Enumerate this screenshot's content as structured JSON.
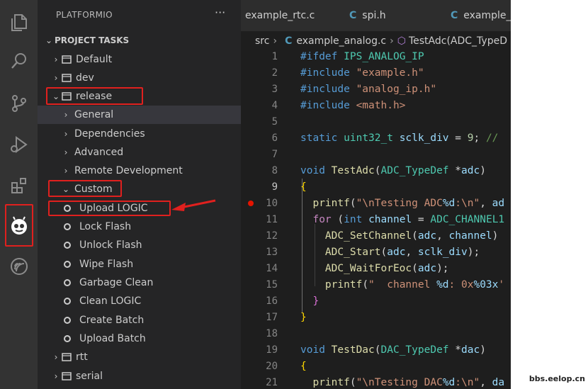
{
  "activity_bar": {
    "icons": [
      "files-icon",
      "search-icon",
      "source-control-icon",
      "run-debug-icon",
      "extensions-icon",
      "platformio-icon",
      "espressif-icon"
    ]
  },
  "sidebar": {
    "title": "PLATFORMIO",
    "more": "···",
    "section": "PROJECT TASKS",
    "items": [
      {
        "label": "Default",
        "chevron": "›",
        "icon": "folder"
      },
      {
        "label": "dev",
        "chevron": "›",
        "icon": "folder"
      },
      {
        "label": "release",
        "chevron": "⌄",
        "icon": "folder"
      },
      {
        "label": "General",
        "chevron": "›"
      },
      {
        "label": "Dependencies",
        "chevron": "›"
      },
      {
        "label": "Advanced",
        "chevron": "›"
      },
      {
        "label": "Remote Development",
        "chevron": "›"
      },
      {
        "label": "Custom",
        "chevron": "⌄"
      },
      {
        "label": "Upload LOGIC",
        "icon": "dot"
      },
      {
        "label": "Lock Flash",
        "icon": "dot"
      },
      {
        "label": "Unlock Flash",
        "icon": "dot"
      },
      {
        "label": "Wipe Flash",
        "icon": "dot"
      },
      {
        "label": "Garbage Clean",
        "icon": "dot"
      },
      {
        "label": "Clean LOGIC",
        "icon": "dot"
      },
      {
        "label": "Create Batch",
        "icon": "dot"
      },
      {
        "label": "Upload Batch",
        "icon": "dot"
      },
      {
        "label": "rtt",
        "chevron": "›",
        "icon": "folder"
      },
      {
        "label": "serial",
        "chevron": "›",
        "icon": "folder"
      }
    ]
  },
  "tabs": [
    {
      "label": "example_rtc.c",
      "lang": ""
    },
    {
      "label": "spi.h",
      "lang": "C"
    },
    {
      "label": "example_",
      "lang": "C"
    }
  ],
  "breadcrumb": {
    "folder": "src",
    "file_lang": "C",
    "file": "example_analog.c",
    "symbol": "TestAdc(ADC_TypeD"
  },
  "line_numbers": [
    "1",
    "2",
    "3",
    "4",
    "5",
    "6",
    "7",
    "8",
    "9",
    "10",
    "11",
    "12",
    "13",
    "14",
    "15",
    "16",
    "17",
    "18",
    "19",
    "20",
    "21"
  ],
  "watermark": "bbs.eelop.cn",
  "colors": {
    "highlight": "#e0201e",
    "activity_bg": "#333333",
    "sidebar_bg": "#252526",
    "editor_bg": "#1e1e1e"
  }
}
